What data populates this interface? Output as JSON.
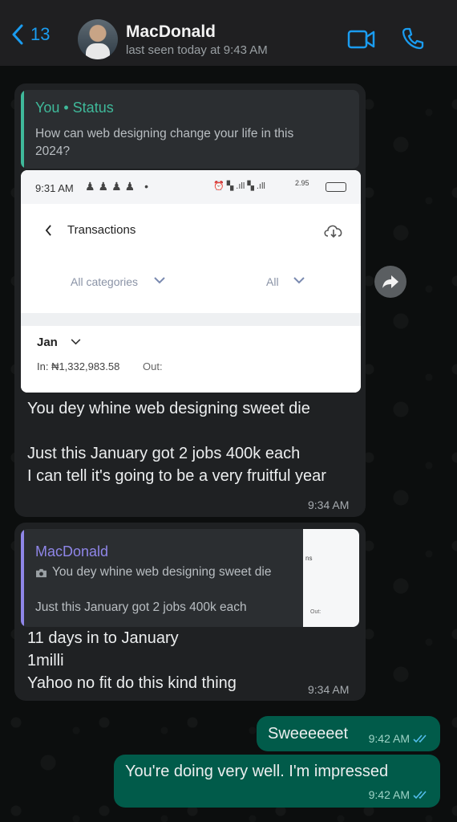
{
  "header": {
    "back_count": "13",
    "contact_name": "MacDonald",
    "last_seen": "last seen today at 9:43 AM"
  },
  "message1": {
    "quote_author": "You • Status",
    "quote_text": "How can web designing change your life in this 2024?",
    "screenshot": {
      "status_time": "9:31 AM",
      "status_right": "2.95",
      "title": "Transactions",
      "filter_category": "All categories",
      "filter_type": "All",
      "month": "Jan",
      "in_label": "In: ₦1,332,983.58",
      "out_label": "Out:"
    },
    "text": "You dey whine web designing sweet die\n\nJust this January got 2 jobs 400k each\n I can tell it's going to be a very fruitful year",
    "time": "9:34 AM"
  },
  "message2": {
    "quote_author": "MacDonald",
    "quote_line1": "You dey whine web designing sweet die",
    "quote_line2": "Just this January got 2 jobs 400k each",
    "thumb_fragment1": "ns",
    "thumb_fragment2": "Out:",
    "text": "11 days in to January\n1milli\nYahoo no fit do this kind thing",
    "time": "9:34 AM"
  },
  "message3": {
    "text": "Sweeeeeet",
    "time": "9:42 AM"
  },
  "message4": {
    "text": "You're doing very well. I'm impressed",
    "time": "9:42 AM"
  },
  "colors": {
    "accent_blue": "#1a9cf0",
    "status_quote": "#3fb99a",
    "reply_quote": "#8f86e8",
    "outgoing_bubble": "#015b4a",
    "incoming_bubble": "#1f2123"
  }
}
